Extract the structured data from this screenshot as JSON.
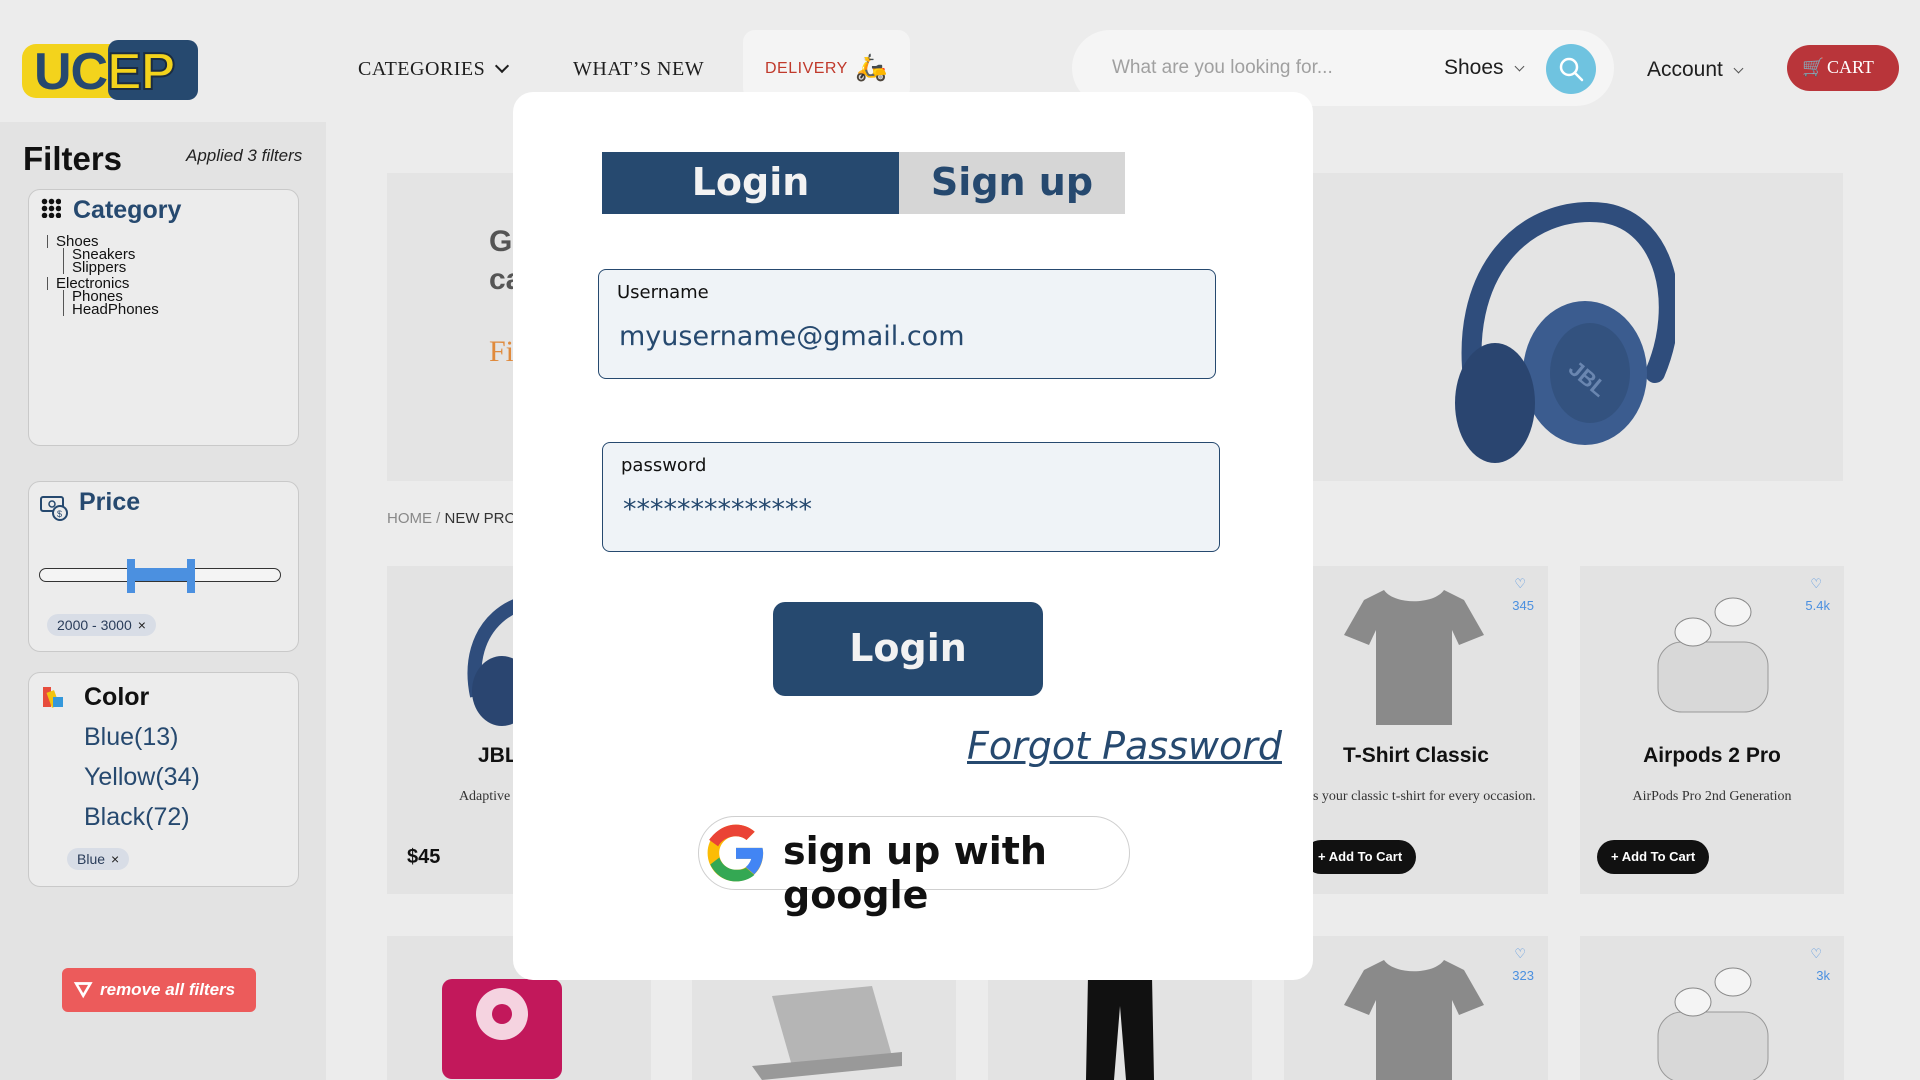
{
  "header": {
    "logo_text": "UCEP",
    "nav": {
      "categories": "CATEGORIES",
      "whats_new": "WHAT’S NEW",
      "delivery": "DELIVERY"
    },
    "search": {
      "placeholder": "What are you looking for...",
      "category": "Shoes"
    },
    "account": "Account",
    "cart": "CART"
  },
  "sidebar": {
    "title": "Filters",
    "applied": "Applied 3 filters",
    "category": {
      "title": "Category",
      "tree": [
        {
          "label": "Shoes",
          "children": [
            "Sneakers",
            "Slippers"
          ]
        },
        {
          "label": "Electronics",
          "children": [
            "Phones",
            "HeadPhones"
          ]
        }
      ]
    },
    "price": {
      "title": "Price",
      "chip": "2000 - 3000",
      "range_min_fraction": 0.36,
      "range_max_fraction": 0.64
    },
    "color": {
      "title": "Color",
      "options": [
        "Blue(13)",
        "Yellow(34)",
        "Black(72)"
      ],
      "chip": "Blue"
    },
    "remove_all": "remove all filters"
  },
  "main": {
    "banner": {
      "heading_line1": "G",
      "heading_line2": "ca",
      "link": "Fi"
    },
    "breadcrumb": {
      "home": "HOME",
      "sep": " / ",
      "current": "NEW PRO"
    },
    "products": [
      {
        "title": "JBL Tun",
        "desc": "Adaptive Noise c hea",
        "price": "$45"
      },
      {
        "title": "T-Shirt Classic",
        "desc": "is is your classic t-shirt for every occasion.",
        "likes": "345",
        "add": "Add To Cart"
      },
      {
        "title": "Airpods 2 Pro",
        "desc": "AirPods Pro 2nd Generation",
        "likes": "5.4k",
        "add": "Add To Cart"
      }
    ],
    "second_row_likes": [
      "323",
      "3k"
    ]
  },
  "modal": {
    "tabs": {
      "login": "Login",
      "signup": "Sign up"
    },
    "username": {
      "label": "Username",
      "value": "myusername@gmail.com"
    },
    "password": {
      "label": "password",
      "value": "**************"
    },
    "login_button": "Login",
    "forgot": "Forgot Password",
    "google": "sign up with google"
  },
  "colors": {
    "primary": "#26496f",
    "accent_red": "#b9353a",
    "logo_yellow": "#f3d31c",
    "search_blue": "#6fc3e0",
    "remove_red": "#ec5b5b"
  }
}
